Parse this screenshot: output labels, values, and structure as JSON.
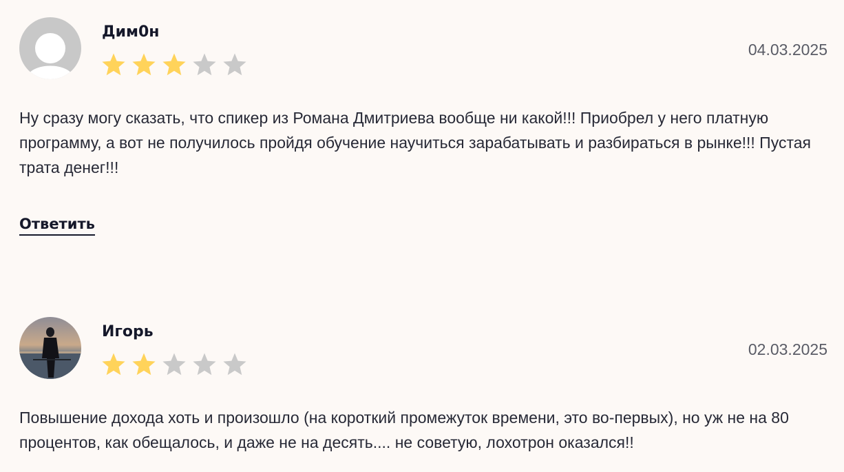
{
  "reviews": [
    {
      "author": "Дим0н",
      "date": "04.03.2025",
      "rating": 3,
      "max_rating": 5,
      "text": "Ну сразу могу сказать, что спикер из Романа Дмитриева вообще ни какой!!! Приобрел у него платную программу, а вот не получилось пройдя обучение научиться зарабатывать и разбираться в рынке!!! Пустая трата денег!!!",
      "reply_label": "Ответить",
      "avatar": "default-user-icon"
    },
    {
      "author": "Игорь",
      "date": "02.03.2025",
      "rating": 2,
      "max_rating": 5,
      "text": "Повышение дохода хоть и произошло (на короткий промежуток времени, это во-первых), но уж не на 80 процентов, как обещалось, и даже не на десять.... не советую, лохотрон оказался!!",
      "avatar": "user-photo"
    }
  ],
  "colors": {
    "star_filled": "#ffd35a",
    "star_empty": "#c9c9c9",
    "background": "#fdf9f6"
  }
}
